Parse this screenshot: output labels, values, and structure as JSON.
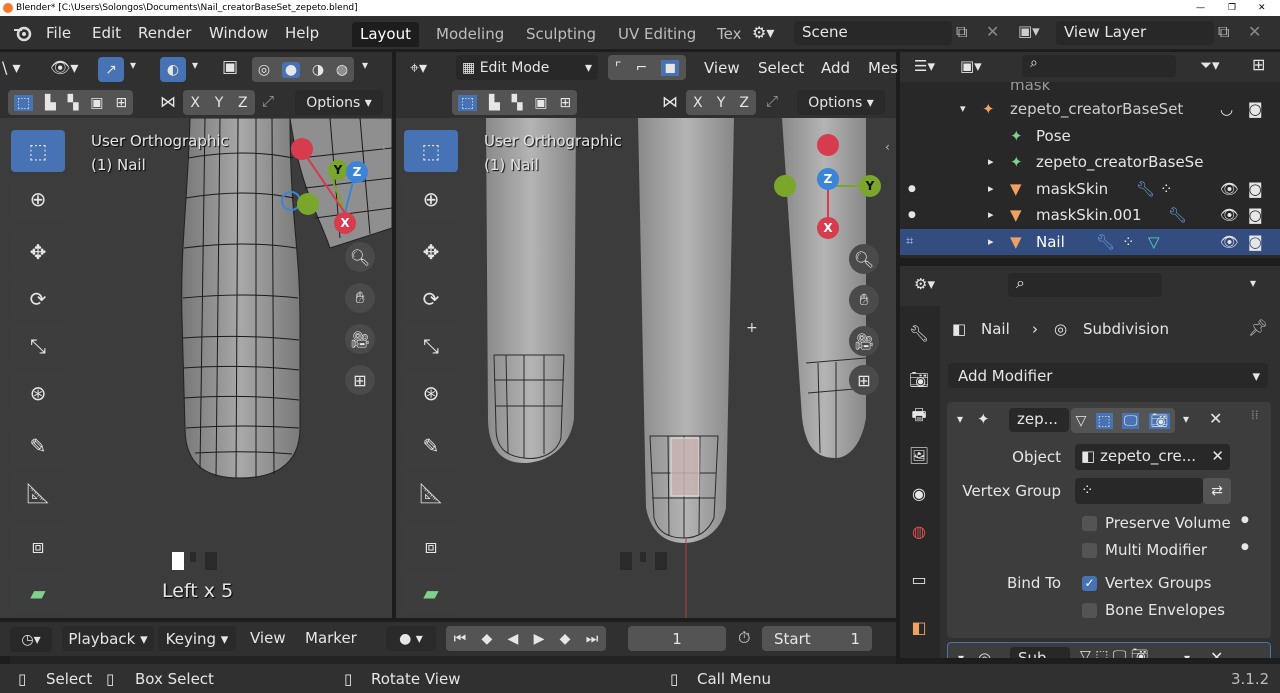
{
  "window": {
    "title": "Blender* [C:\\Users\\Solongos\\Documents\\Nail_creatorBaseSet_zepeto.blend]"
  },
  "menu": {
    "file": "File",
    "edit": "Edit",
    "render": "Render",
    "window": "Window",
    "help": "Help"
  },
  "workspaces": [
    "Layout",
    "Modeling",
    "Sculpting",
    "UV Editing",
    "Tex"
  ],
  "scene": {
    "name": "Scene",
    "view_layer": "View Layer"
  },
  "viewport_left": {
    "axes": [
      "X",
      "Y",
      "Z"
    ],
    "options": "Options",
    "view_name": "User Orthographic",
    "object": "(1) Nail",
    "operator_text": "Left x 5"
  },
  "viewport_right": {
    "mode": "Edit Mode",
    "menus": [
      "View",
      "Select",
      "Add",
      "Mes"
    ],
    "axes": [
      "X",
      "Y",
      "Z"
    ],
    "options": "Options",
    "view_name": "User Orthographic",
    "object": "(1) Nail"
  },
  "gizmo": {
    "x": "X",
    "y": "Y",
    "z": "Z"
  },
  "timeline": {
    "playback": "Playback",
    "keying": "Keying",
    "view": "View",
    "marker": "Marker",
    "frame": "1",
    "start_label": "Start",
    "start_value": "1"
  },
  "outliner": {
    "items": [
      {
        "name": "mask",
        "indent": 0
      },
      {
        "name": "zepeto_creatorBaseSet",
        "indent": 1
      },
      {
        "name": "Pose",
        "indent": 2
      },
      {
        "name": "zepeto_creatorBaseSe",
        "indent": 2
      },
      {
        "name": "maskSkin",
        "indent": 2
      },
      {
        "name": "maskSkin.001",
        "indent": 2
      },
      {
        "name": "Nail",
        "indent": 2,
        "selected": true
      }
    ]
  },
  "properties": {
    "breadcrumb_object": "Nail",
    "breadcrumb_modifier": "Subdivision",
    "add_modifier": "Add Modifier",
    "armature_mod": {
      "name": "zep...",
      "object_label": "Object",
      "object_value": "zepeto_cre...",
      "vertex_group_label": "Vertex Group",
      "preserve_volume": "Preserve Volume",
      "multi_modifier": "Multi Modifier",
      "bind_to_label": "Bind To",
      "vertex_groups": "Vertex Groups",
      "bone_envelopes": "Bone Envelopes"
    },
    "subsurf_mod": {
      "name": "Sub..."
    }
  },
  "statusbar": {
    "select": "Select",
    "box_select": "Box Select",
    "rotate_view": "Rotate View",
    "call_menu": "Call Menu",
    "version": "3.1.2"
  },
  "colors": {
    "accent": "#4772b3",
    "header": "#303030",
    "viewport": "#3c3c3c",
    "axis_x": "#d63b4e",
    "axis_y": "#7aa62b",
    "axis_z": "#3b84d6"
  }
}
